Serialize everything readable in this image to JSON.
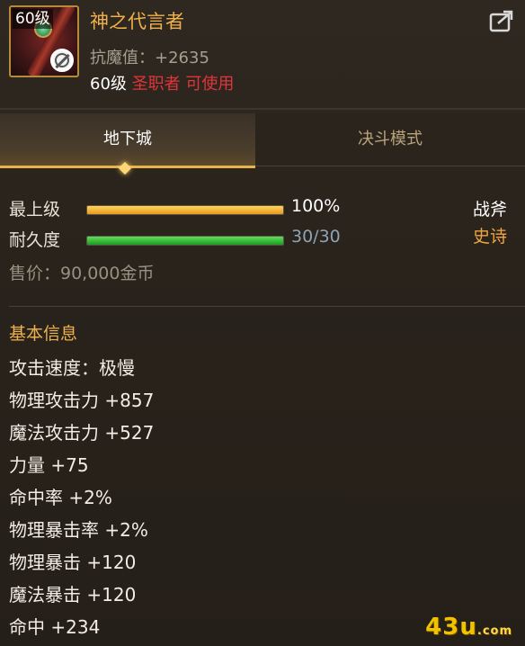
{
  "item": {
    "level_badge": "60级",
    "name": "神之代言者",
    "resist": "抗魔值：+2635",
    "req_level": "60级",
    "req_class": "圣职者",
    "req_use": "可使用"
  },
  "tabs": [
    {
      "label": "地下城",
      "active": true
    },
    {
      "label": "决斗模式",
      "active": false
    }
  ],
  "stats": {
    "upgrade": {
      "label": "最上级",
      "value": "100%",
      "fill": 1.0
    },
    "durability": {
      "label": "耐久度",
      "value": "30/30",
      "fill": 1.0
    }
  },
  "weapon_type": "战斧",
  "rarity": "史诗",
  "price": "售价：90,000金币",
  "basic_info": {
    "title": "基本信息",
    "attributes": [
      "攻击速度：极慢",
      "物理攻击力 +857",
      "魔法攻击力 +527",
      "力量 +75",
      "命中率 +2%",
      "物理暴击率 +2%",
      "物理暴击 +120",
      "魔法暴击 +120",
      "命中 +234"
    ]
  },
  "watermark": {
    "main": "43u",
    "suffix": ".com"
  },
  "colors": {
    "item_name": "#f0b04a",
    "restriction": "#e0353a",
    "rarity": "#f0a640",
    "upgrade_bar": "#e79820",
    "durability_bar": "#1d9a23"
  },
  "icons": {
    "share": "share-arrow-icon",
    "no_use": "prohibited-icon"
  }
}
